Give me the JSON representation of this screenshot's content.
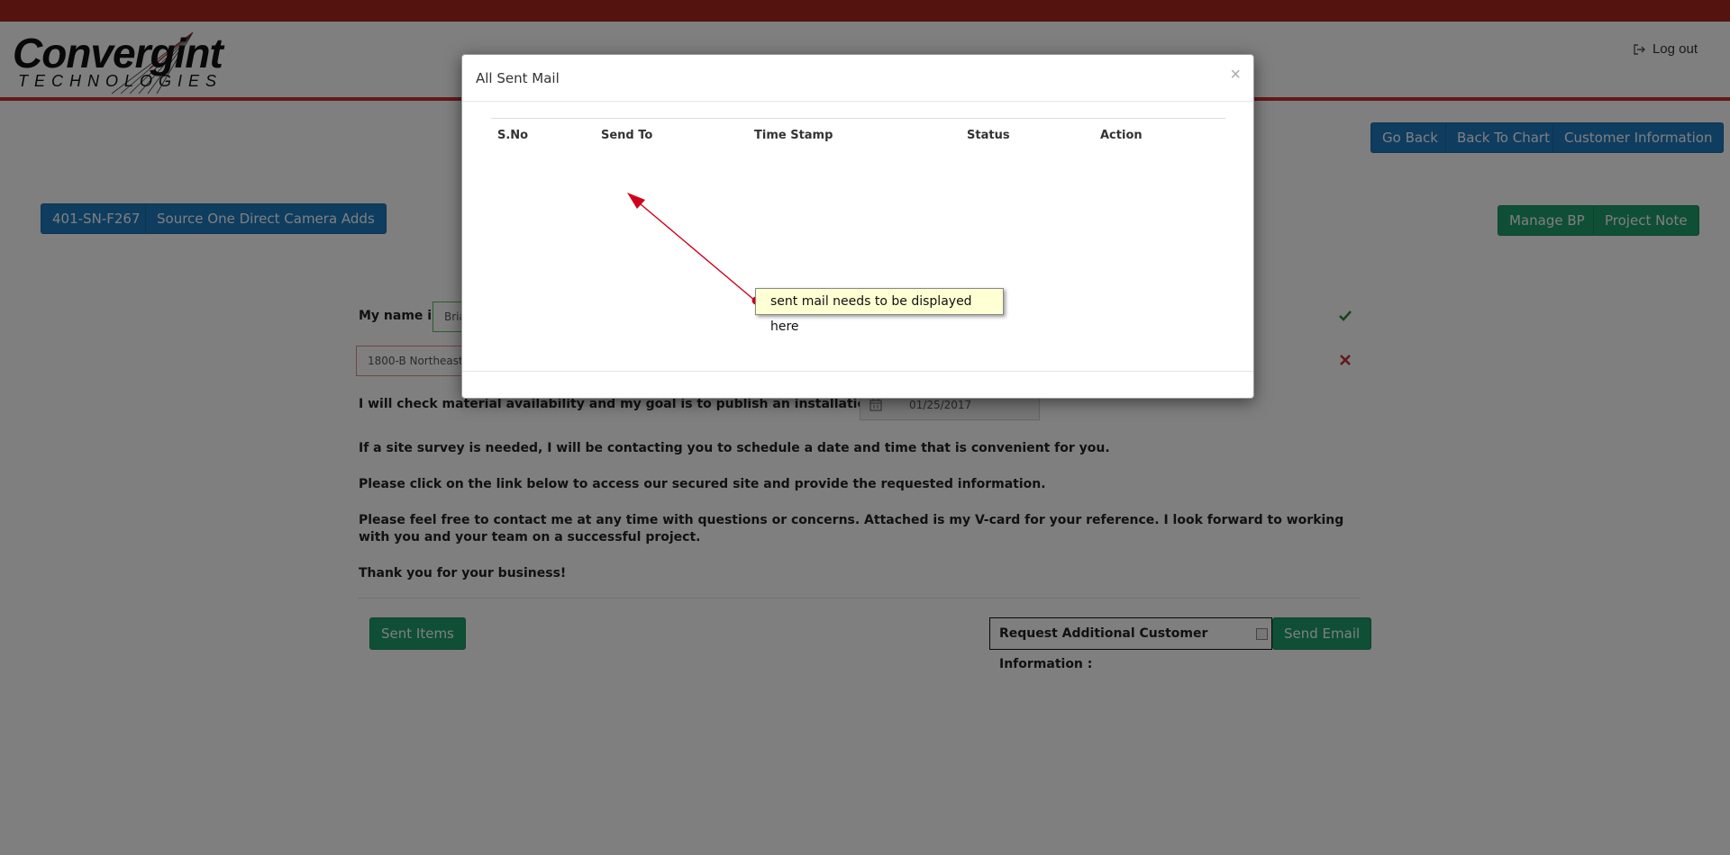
{
  "header": {
    "logo_word": "Convergint",
    "logo_sub": "TECHNOLOGIES",
    "logout_label": "Log out",
    "logout_icon": "sign-out-icon"
  },
  "nav_buttons": {
    "go_back": "Go Back",
    "back_to_chart": "Back To Chart",
    "customer_information": "Customer Information",
    "manage_bp": "Manage BP",
    "project_note": "Project Note"
  },
  "project": {
    "id_label": "401-SN-F267",
    "name_label": "Source One Direct Camera Adds"
  },
  "form": {
    "my_name_label": "My name is",
    "my_name_value": "Bria",
    "address_value": "1800-B Northeast",
    "schedule_label": "I will check material availability and my goal is to publish an installation schedule by",
    "schedule_date": "01/25/2017",
    "para_site_survey": "If a site survey is needed, I will be contacting you to schedule a date and time that is convenient for you.",
    "para_link": "Please click on the link below to access our secured site and provide the requested information.",
    "para_contact": "Please feel free to contact me at any time with questions or concerns. Attached is my V-card for your reference. I look forward to working with you and your team on a successful project.",
    "para_thanks": "Thank you for your business!",
    "sent_items_label": "Sent Items",
    "request_info_label": "Request Additional Customer Information :",
    "send_email_label": "Send Email",
    "status_ok_color": "#2e8b3a",
    "status_err_color": "#c9302c"
  },
  "modal": {
    "title": "All Sent Mail",
    "close_glyph": "×",
    "columns": [
      "S.No",
      "Send To",
      "Time Stamp",
      "Status",
      "Action"
    ],
    "rows": []
  },
  "annotation": {
    "text": "sent mail needs to be displayed here",
    "color": "#d0021b"
  }
}
